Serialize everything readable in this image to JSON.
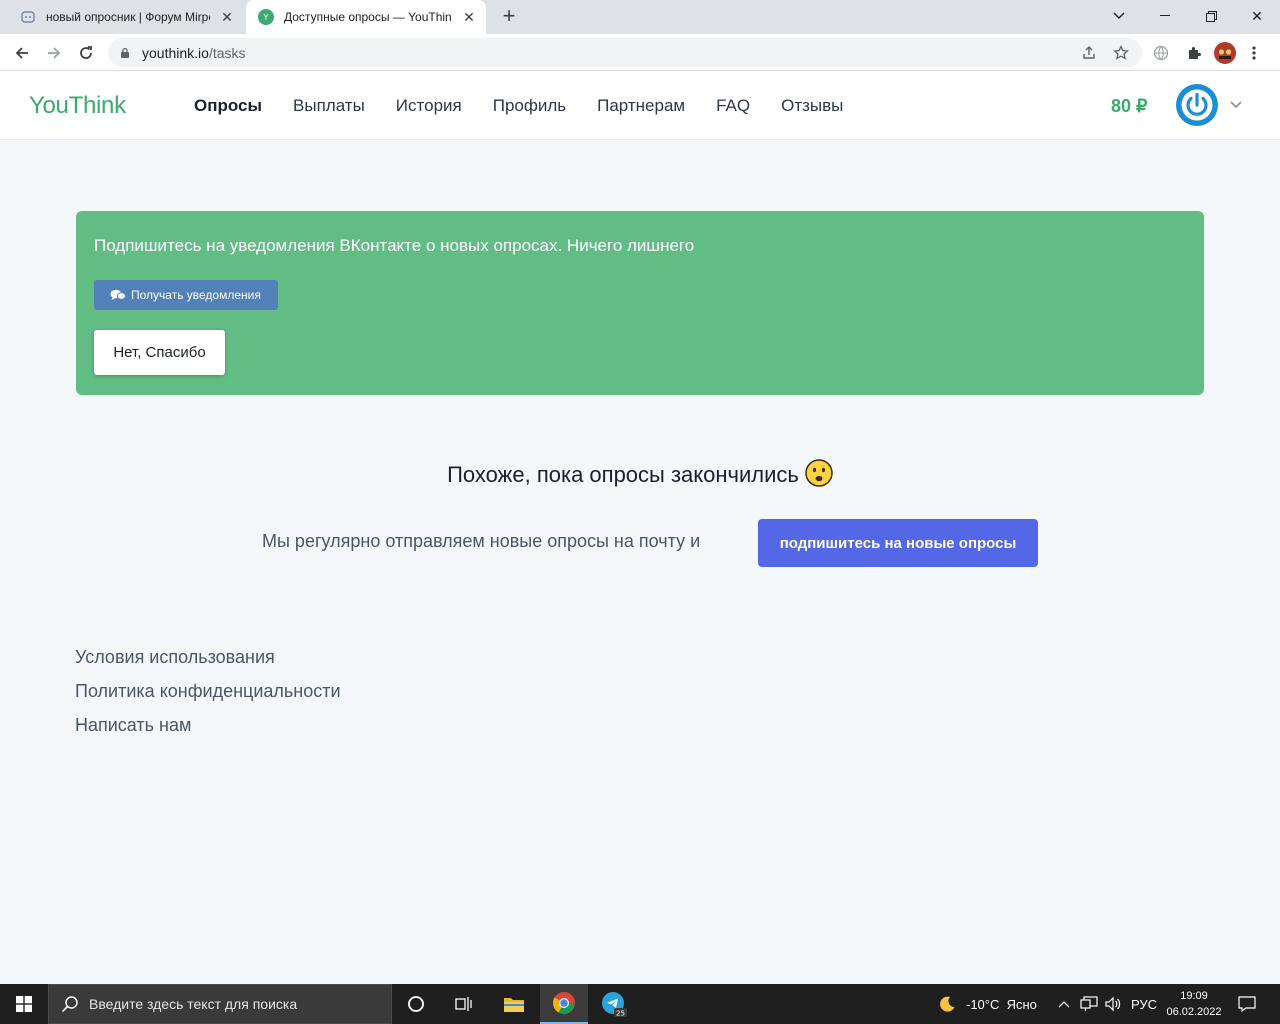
{
  "browser": {
    "tabs": [
      {
        "title": "новый опросник | Форум Mirpe",
        "active": false
      },
      {
        "title": "Доступные опросы — YouThink",
        "active": true
      }
    ],
    "url_host": "youthink.io",
    "url_path": "/tasks"
  },
  "site": {
    "logo": "YouThink",
    "nav": [
      "Опросы",
      "Выплаты",
      "История",
      "Профиль",
      "Партнерам",
      "FAQ",
      "Отзывы"
    ],
    "balance": "80 ₽"
  },
  "notice": {
    "text": "Подпишитесь на уведомления ВКонтакте о новых опросах. Ничего лишнего",
    "vk_button": "Получать уведомления",
    "decline_button": "Нет, Спасибо",
    "bg_color": "#62bd85"
  },
  "empty_state": {
    "title": "Похоже, пока опросы закончились",
    "text": "Мы регулярно отправляем новые опросы на почту и",
    "button": "подпишитесь на новые опросы",
    "button_color": "#5468e7"
  },
  "footer": {
    "links": [
      "Условия использования",
      "Политика конфиденциальности",
      "Написать нам"
    ]
  },
  "taskbar": {
    "search_placeholder": "Введите здесь текст для поиска",
    "weather": "-10°C  Ясно",
    "language": "РУС",
    "time": "19:09",
    "date": "06.02.2022",
    "telegram_badge": "25"
  }
}
